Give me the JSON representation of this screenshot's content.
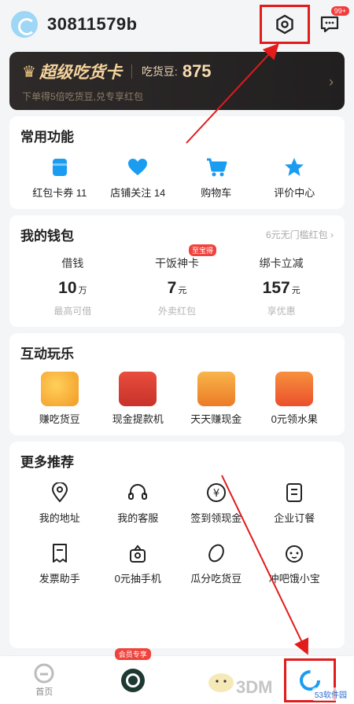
{
  "header": {
    "username": "30811579b",
    "msg_badge": "99+"
  },
  "vip": {
    "title": "超级吃货卡",
    "coin_label": "吃货豆:",
    "coin_value": "875",
    "subtitle": "下单得5倍吃货豆,兑专享红包"
  },
  "common": {
    "title": "常用功能",
    "items": [
      {
        "label": "红包卡券 11",
        "icon": "wallet-icon"
      },
      {
        "label": "店铺关注 14",
        "icon": "heart-icon"
      },
      {
        "label": "购物车",
        "icon": "cart-icon"
      },
      {
        "label": "评价中心",
        "icon": "star-icon"
      }
    ]
  },
  "wallet": {
    "title": "我的钱包",
    "link": "6元无门槛红包",
    "items": [
      {
        "label": "借钱",
        "value": "10",
        "unit": "万",
        "desc": "最高可借",
        "tag": ""
      },
      {
        "label": "干饭神卡",
        "value": "7",
        "unit": "元",
        "desc": "外卖红包",
        "tag": "至宝得"
      },
      {
        "label": "绑卡立减",
        "value": "157",
        "unit": "元",
        "desc": "享优惠",
        "tag": ""
      }
    ]
  },
  "fun": {
    "title": "互动玩乐",
    "items": [
      {
        "label": "赚吃货豆",
        "color": "#f6b03a"
      },
      {
        "label": "现金提款机",
        "color": "#e94d3d"
      },
      {
        "label": "天天赚现金",
        "color": "#f08f2b"
      },
      {
        "label": "0元领水果",
        "color": "#f26a32"
      }
    ]
  },
  "more": {
    "title": "更多推荐",
    "items": [
      {
        "label": "我的地址",
        "icon": "location-icon"
      },
      {
        "label": "我的客服",
        "icon": "headset-icon"
      },
      {
        "label": "签到领现金",
        "icon": "yen-icon"
      },
      {
        "label": "企业订餐",
        "icon": "document-icon"
      },
      {
        "label": "发票助手",
        "icon": "invoice-icon"
      },
      {
        "label": "0元抽手机",
        "icon": "gift-icon"
      },
      {
        "label": "瓜分吃货豆",
        "icon": "bean-icon"
      },
      {
        "label": "冲吧饿小宝",
        "icon": "mascot-icon"
      }
    ]
  },
  "bottom_nav": {
    "home_label": "首页",
    "promo_tag": "会员专享"
  },
  "watermark": "53软件园",
  "watermark2": "3DM"
}
